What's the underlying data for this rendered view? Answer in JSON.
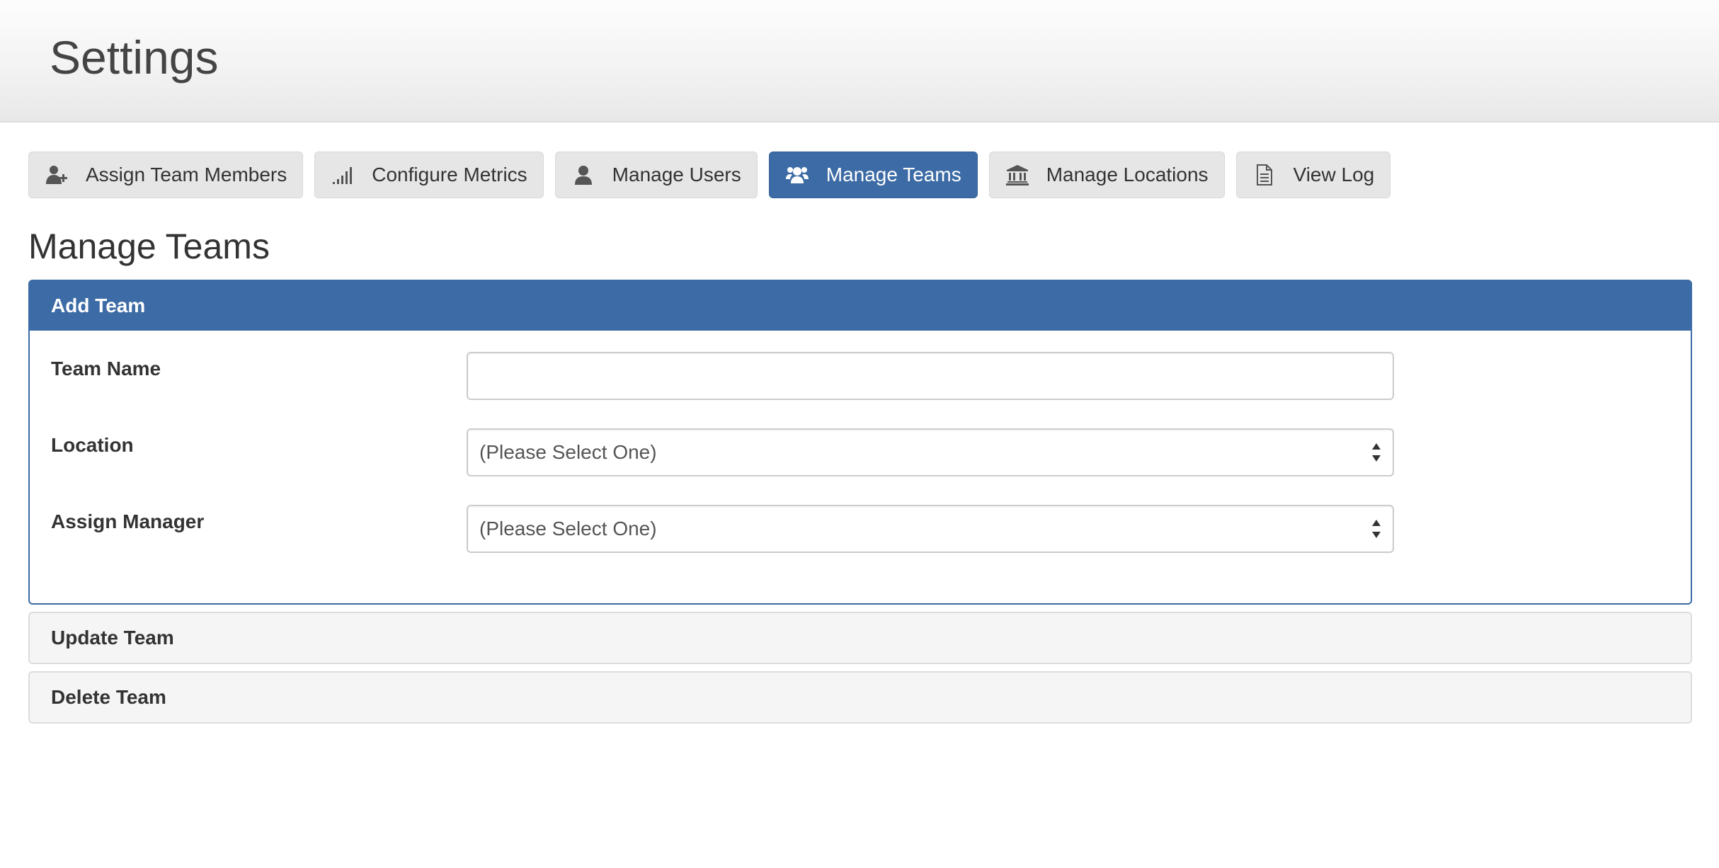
{
  "header": {
    "title": "Settings"
  },
  "nav": {
    "buttons": [
      {
        "label": "Assign Team Members",
        "icon": "user-plus-icon"
      },
      {
        "label": "Configure Metrics",
        "icon": "signal-bars-icon"
      },
      {
        "label": "Manage Users",
        "icon": "user-icon"
      },
      {
        "label": "Manage Teams",
        "icon": "users-group-icon",
        "active": true
      },
      {
        "label": "Manage Locations",
        "icon": "bank-building-icon"
      },
      {
        "label": "View Log",
        "icon": "document-icon"
      }
    ]
  },
  "page": {
    "heading": "Manage Teams"
  },
  "add_team": {
    "title": "Add Team",
    "team_name_label": "Team Name",
    "team_name_value": "",
    "location_label": "Location",
    "location_value": "(Please Select One)",
    "manager_label": "Assign Manager",
    "manager_value": "(Please Select One)"
  },
  "update_team": {
    "title": "Update Team"
  },
  "delete_team": {
    "title": "Delete Team"
  },
  "colors": {
    "accent": "#3c6ba5",
    "button_bg": "#e6e6e6",
    "header_bg": "#f2f2f2"
  }
}
